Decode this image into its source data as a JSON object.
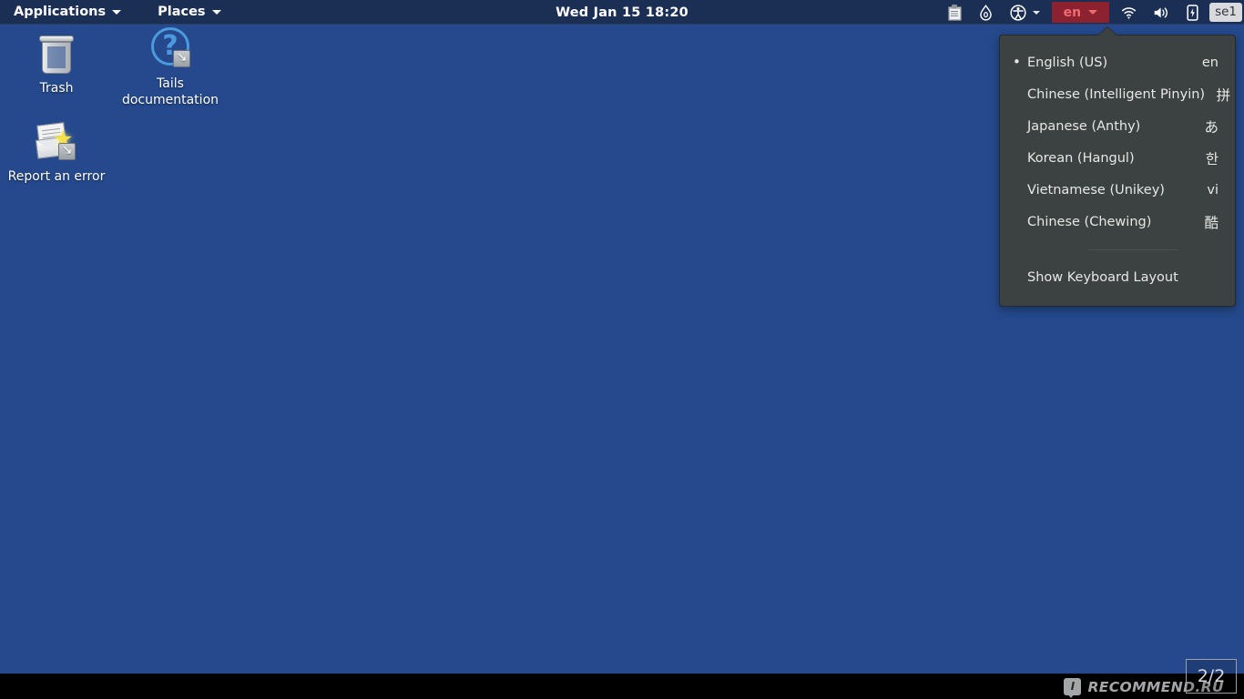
{
  "topbar": {
    "applications_label": "Applications",
    "places_label": "Places",
    "clock": "Wed Jan 15  18:20",
    "tray": {
      "clipboard_icon": "clipboard-icon",
      "tor_icon": "onion-droplet-icon",
      "accessibility_icon": "accessibility-icon",
      "keyboard_label": "en",
      "wifi_icon": "wifi-icon",
      "volume_icon": "volume-icon",
      "battery_icon": "battery-icon",
      "session_chip": "se1"
    }
  },
  "keyboard_menu": {
    "items": [
      {
        "marker": "•",
        "name": "English (US)",
        "short": "en",
        "cjk": false
      },
      {
        "marker": "",
        "name": "Chinese (Intelligent Pinyin)",
        "short": "拼",
        "cjk": true
      },
      {
        "marker": "",
        "name": "Japanese (Anthy)",
        "short": "あ",
        "cjk": true
      },
      {
        "marker": "",
        "name": "Korean (Hangul)",
        "short": "한",
        "cjk": true
      },
      {
        "marker": "",
        "name": "Vietnamese (Unikey)",
        "short": "vi",
        "cjk": false
      },
      {
        "marker": "",
        "name": "Chinese (Chewing)",
        "short": "酷",
        "cjk": true
      }
    ],
    "action_label": "Show Keyboard Layout"
  },
  "desktop": {
    "icons": [
      {
        "label": "Trash",
        "icon": "trash-icon"
      },
      {
        "label": "Tails\ndocumentation",
        "label_line1": "Tails",
        "label_line2": "documentation",
        "icon": "help-question-icon"
      },
      {
        "label": "Report an error",
        "icon": "report-error-icon"
      }
    ]
  },
  "overlay": {
    "watermark_text": "RECOMMEND.RU",
    "watermark_badge": "I",
    "page_counter": "2/2"
  },
  "colors": {
    "desktop_background": "#25498c",
    "topbar_background": "#1b2f54",
    "keyboard_button": "#8c2230",
    "keyboard_button_text": "#f06a72",
    "menu_background": "#3c4241",
    "menu_text": "#e6e8e6"
  }
}
